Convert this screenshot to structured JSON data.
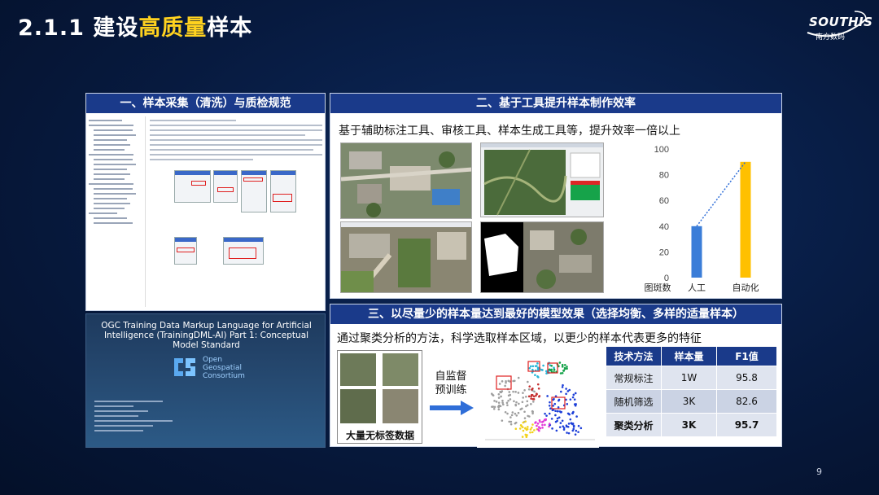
{
  "header": {
    "title_prefix": "2.1.1 建设",
    "title_highlight": "高质量",
    "title_suffix": "样本"
  },
  "logo": {
    "word": "SOUTHIS",
    "sub": "南方数码"
  },
  "page_number": "9",
  "panel1": {
    "heading": "一、样本采集（清洗）与质检规范",
    "standard": {
      "title": "OGC Training Data Markup Language for Artificial Intelligence (TrainingDML-AI) Part 1: Conceptual Model Standard",
      "org_line1": "Open",
      "org_line2": "Geospatial",
      "org_line3": "Consortium"
    }
  },
  "panel2": {
    "heading": "二、基于工具提升样本制作效率",
    "description": "基于辅助标注工具、审核工具、样本生成工具等，提升效率一倍以上"
  },
  "chart_data": {
    "type": "bar",
    "categories": [
      "人工",
      "自动化"
    ],
    "values": [
      40,
      90
    ],
    "xlabel": "图斑数",
    "ylim": [
      0,
      100
    ],
    "yticks": [
      0,
      20,
      40,
      60,
      80,
      100
    ],
    "colors": [
      "#3b7dd8",
      "#ffc000"
    ],
    "trend_line": "dotted"
  },
  "panel3": {
    "heading": "三、以尽量少的样本量达到最好的模型效果（选择均衡、多样的适量样本）",
    "description": "通过聚类分析的方法，科学选取样本区域，以更少的样本代表更多的特征",
    "unlabeled_caption": "大量无标签数据",
    "ssl_line1": "自监督",
    "ssl_line2": "预训练",
    "table": {
      "headers": [
        "技术方法",
        "样本量",
        "F1值"
      ],
      "rows": [
        [
          "常规标注",
          "1W",
          "95.8"
        ],
        [
          "随机筛选",
          "3K",
          "82.6"
        ],
        [
          "聚类分析",
          "3K",
          "95.7"
        ]
      ]
    }
  }
}
